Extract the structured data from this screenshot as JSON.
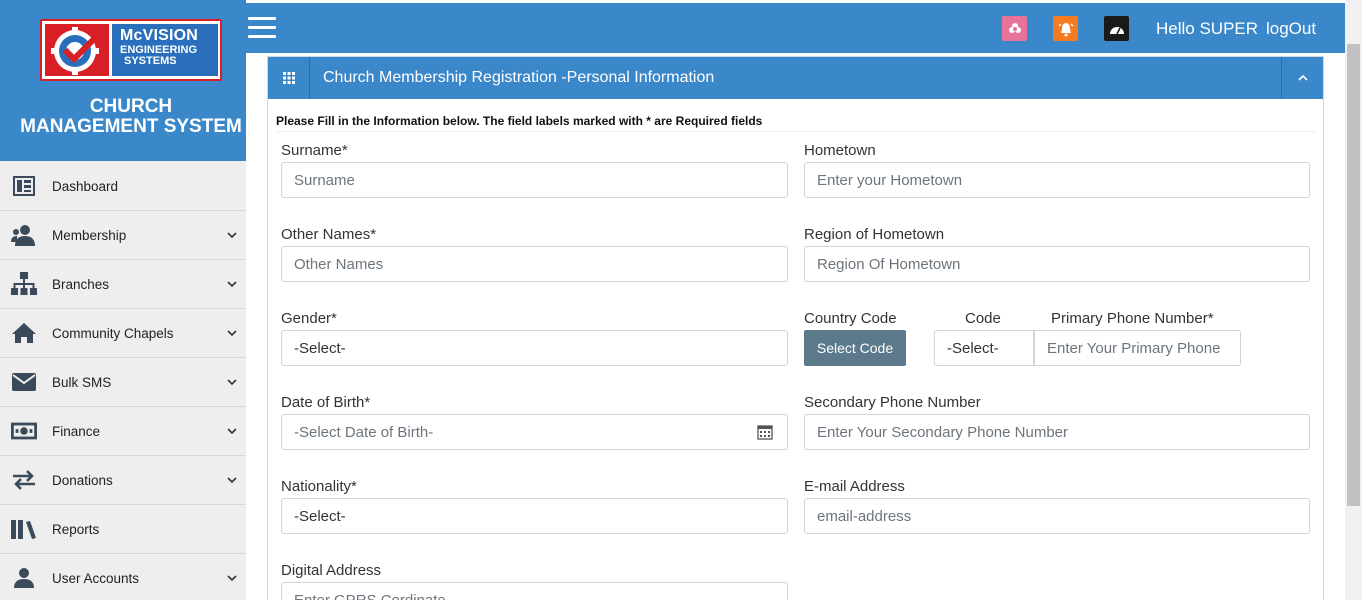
{
  "brand": {
    "logo_line1": "McVISION",
    "logo_line2": "ENGINEERING",
    "logo_line3": "SYSTEMS",
    "title_line1": "CHURCH",
    "title_line2": "MANAGEMENT SYSTEM"
  },
  "nav": {
    "items": [
      {
        "label": "Dashboard",
        "icon": "dashboard-icon",
        "has_children": false
      },
      {
        "label": "Membership",
        "icon": "members-icon",
        "has_children": true
      },
      {
        "label": "Branches",
        "icon": "sitemap-icon",
        "has_children": true
      },
      {
        "label": "Community Chapels",
        "icon": "home-icon",
        "has_children": true
      },
      {
        "label": "Bulk SMS",
        "icon": "envelope-icon",
        "has_children": true
      },
      {
        "label": "Finance",
        "icon": "money-icon",
        "has_children": true
      },
      {
        "label": "Donations",
        "icon": "exchange-icon",
        "has_children": true
      },
      {
        "label": "Reports",
        "icon": "books-icon",
        "has_children": false
      },
      {
        "label": "User Accounts",
        "icon": "user-icon",
        "has_children": true
      }
    ]
  },
  "topbar": {
    "greeting": "Hello SUPER",
    "logout": "logOut",
    "colors": {
      "bar": "#3a87c9",
      "pink": "#e8739a",
      "orange": "#f47b20",
      "dark": "#1a1a1a"
    }
  },
  "panel": {
    "title": "Church Membership Registration -Personal Information",
    "note": "Please Fill in the Information below. The field labels marked with * are Required fields"
  },
  "form": {
    "surname": {
      "label": "Surname*",
      "placeholder": "Surname"
    },
    "other_names": {
      "label": "Other Names*",
      "placeholder": "Other Names"
    },
    "gender": {
      "label": "Gender*",
      "value": "-Select-"
    },
    "dob": {
      "label": "Date of Birth*",
      "placeholder": "-Select Date of Birth-"
    },
    "nationality": {
      "label": "Nationality*",
      "value": "-Select-"
    },
    "digital_address": {
      "label": "Digital Address",
      "placeholder": "Enter GPRS Cordinate"
    },
    "hometown": {
      "label": "Hometown",
      "placeholder": "Enter your Hometown"
    },
    "region": {
      "label": "Region of Hometown",
      "placeholder": "Region Of Hometown"
    },
    "country_code": {
      "label": "Country Code",
      "button": "Select Code"
    },
    "code": {
      "label": "Code",
      "value": "-Select-"
    },
    "primary_phone": {
      "label": "Primary Phone Number*",
      "placeholder": "Enter Your Primary Phone"
    },
    "secondary_phone": {
      "label": "Secondary Phone Number",
      "placeholder": "Enter Your Secondary Phone Number"
    },
    "email": {
      "label": "E-mail Address",
      "placeholder": "email-address"
    }
  }
}
